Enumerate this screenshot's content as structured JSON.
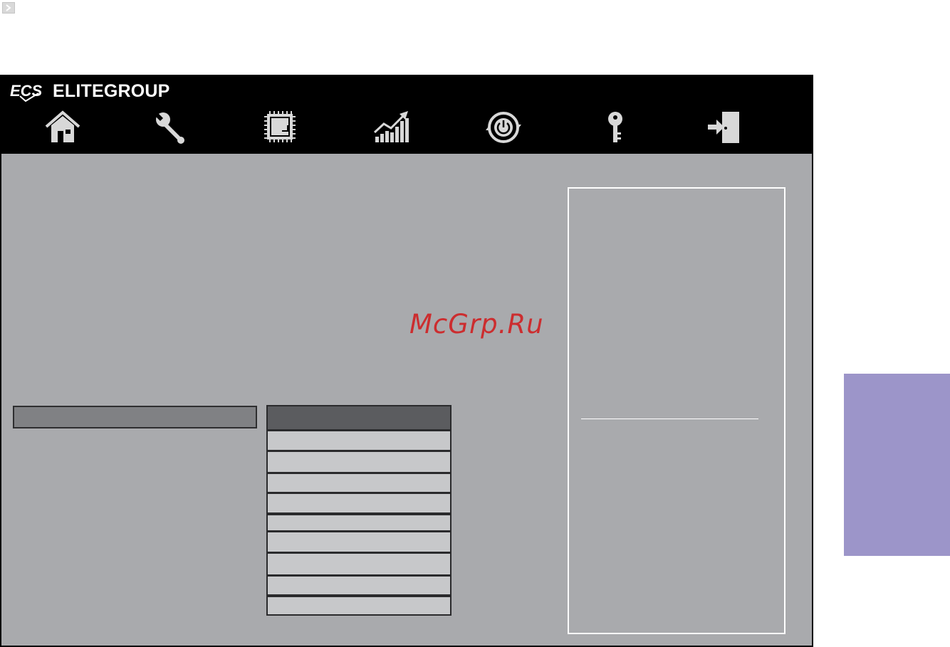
{
  "brand": {
    "name": "ELITEGROUP",
    "logo_text": "ECS"
  },
  "navigation": [
    {
      "icon": "home-icon",
      "label": ""
    },
    {
      "icon": "wrench-icon",
      "label": ""
    },
    {
      "icon": "chip-icon",
      "label": ""
    },
    {
      "icon": "performance-chart-icon",
      "label": ""
    },
    {
      "icon": "power-icon",
      "label": ""
    },
    {
      "icon": "key-icon",
      "label": ""
    },
    {
      "icon": "exit-icon",
      "label": ""
    }
  ],
  "watermark": "McGrp.Ru",
  "colors": {
    "frame_background": "#a9aaad",
    "header_background": "#000000",
    "option_row": "#c7c8ca",
    "menu_header": "#808184",
    "list_header": "#5b5c5f",
    "side_tab": "#9c95c9",
    "watermark": "#cc2d2f"
  }
}
